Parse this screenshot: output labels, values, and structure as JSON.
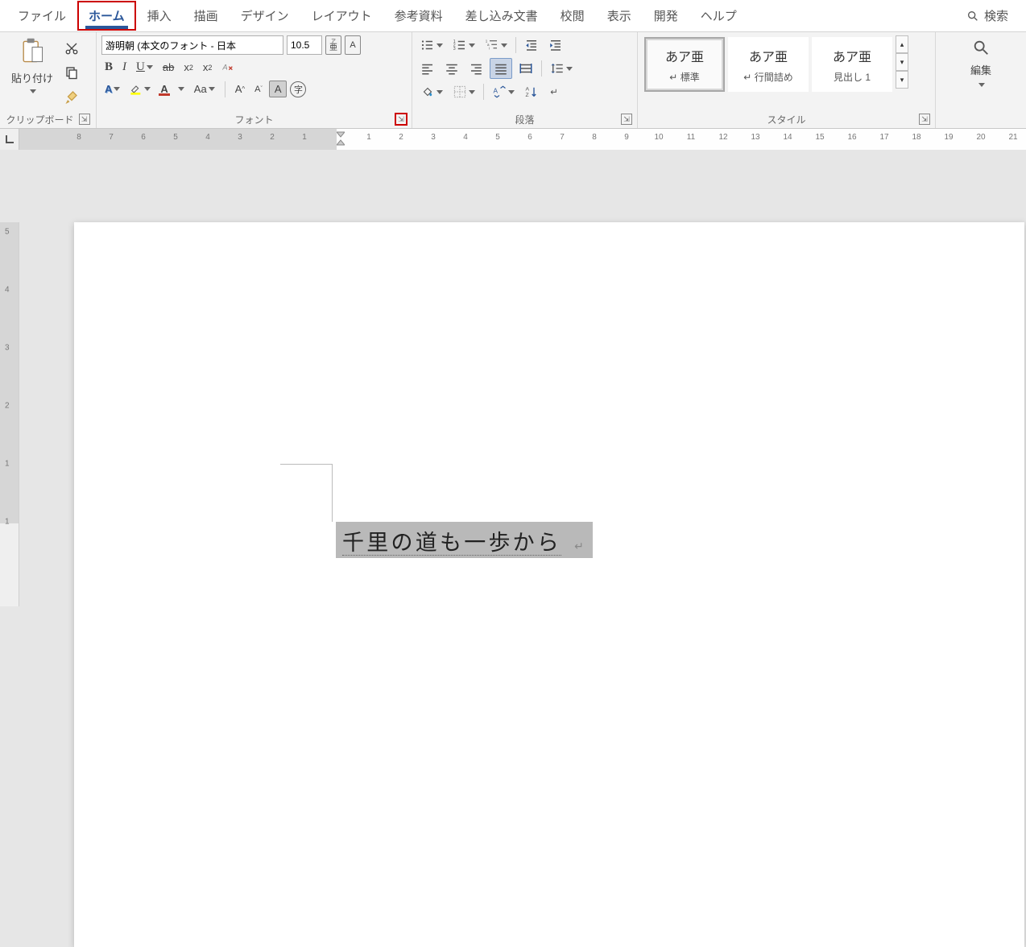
{
  "tabs": {
    "file": "ファイル",
    "home": "ホーム",
    "insert": "挿入",
    "draw": "描画",
    "design": "デザイン",
    "layout": "レイアウト",
    "references": "参考資料",
    "mailings": "差し込み文書",
    "review": "校閲",
    "view": "表示",
    "developer": "開発",
    "help": "ヘルプ",
    "search": "検索"
  },
  "groups": {
    "clipboard": "クリップボード",
    "font": "フォント",
    "paragraph": "段落",
    "styles": "スタイル",
    "editing": "編集"
  },
  "clipboard": {
    "paste": "貼り付け"
  },
  "font": {
    "font_name": "游明朝 (本文のフォント - 日本",
    "font_size": "10.5",
    "ruby_label": "ア亜",
    "charborder": "A",
    "bold": "B",
    "italic": "I",
    "underline": "U",
    "strike": "ab",
    "sub": "x",
    "sup": "x",
    "texteffects": "A",
    "highlight": "A",
    "fontcolor": "A",
    "changecase": "Aa",
    "grow": "A",
    "shrink": "A",
    "highlight2": "A",
    "enclosed": "字"
  },
  "styles": {
    "normal": {
      "sample": "あア亜",
      "name": "標準"
    },
    "nospacing": {
      "sample": "あア亜",
      "name": "行間詰め"
    },
    "heading1": {
      "sample": "あア亜",
      "name": "見出し 1"
    }
  },
  "ruler": {
    "h_negative": [
      "8",
      "7",
      "6",
      "5",
      "4",
      "3",
      "2",
      "1"
    ],
    "h_positive": [
      "1",
      "2",
      "3",
      "4",
      "5",
      "6",
      "7",
      "8",
      "9",
      "10",
      "11",
      "12",
      "13",
      "14",
      "15",
      "16",
      "17",
      "18",
      "19",
      "20",
      "21"
    ],
    "v": [
      "5",
      "4",
      "3",
      "2",
      "1",
      "1"
    ]
  },
  "document": {
    "text": "千里の道も一歩から"
  }
}
